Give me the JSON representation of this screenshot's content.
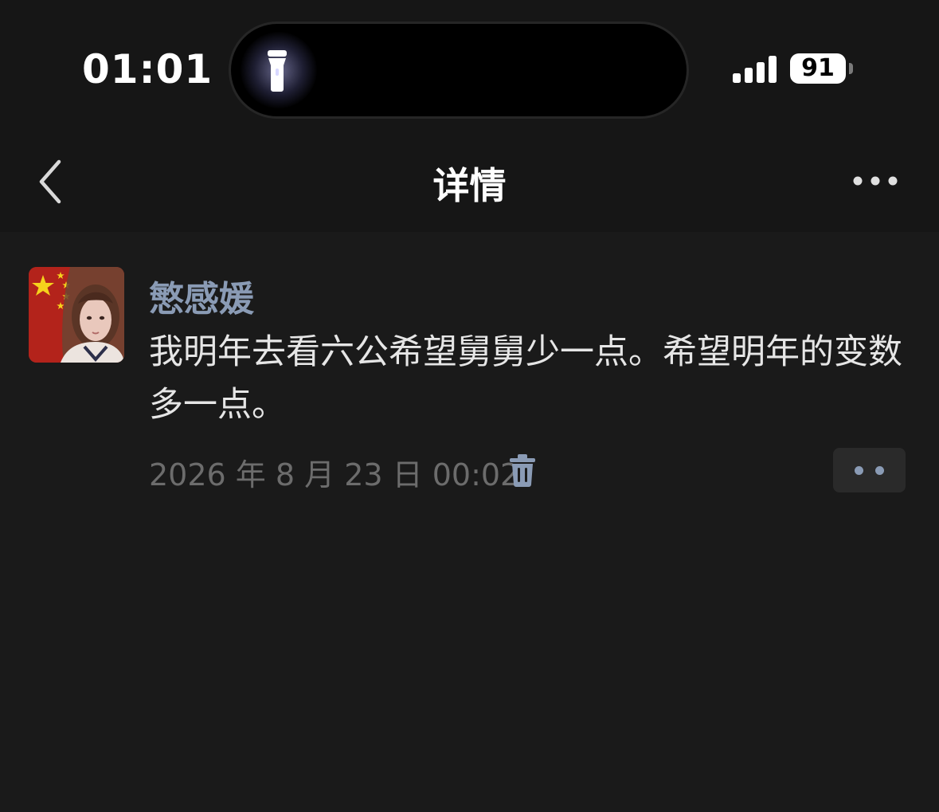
{
  "status_bar": {
    "time": "01:01",
    "battery": "91",
    "flashlight_active": true,
    "icons": [
      "flashlight-icon",
      "cellular-signal-icon",
      "battery-icon"
    ]
  },
  "nav": {
    "title": "详情",
    "icons": [
      "back-chevron-icon",
      "more-horizontal-icon"
    ]
  },
  "post": {
    "author": "慜感媛",
    "body": "我明年去看六公希望舅舅少一点。希望明年的变数多一点。",
    "time": "2026 年 8 月 23 日 00:02",
    "icons": [
      "trash-icon",
      "comment-dots-icon"
    ]
  },
  "colors": {
    "background": "#1a1a1a",
    "bar_background": "#161616",
    "author_name": "#8a9bb5",
    "body_text": "#e6e6e6",
    "meta_text": "#6c6c6c",
    "accent_icon": "#8a9bb5"
  }
}
